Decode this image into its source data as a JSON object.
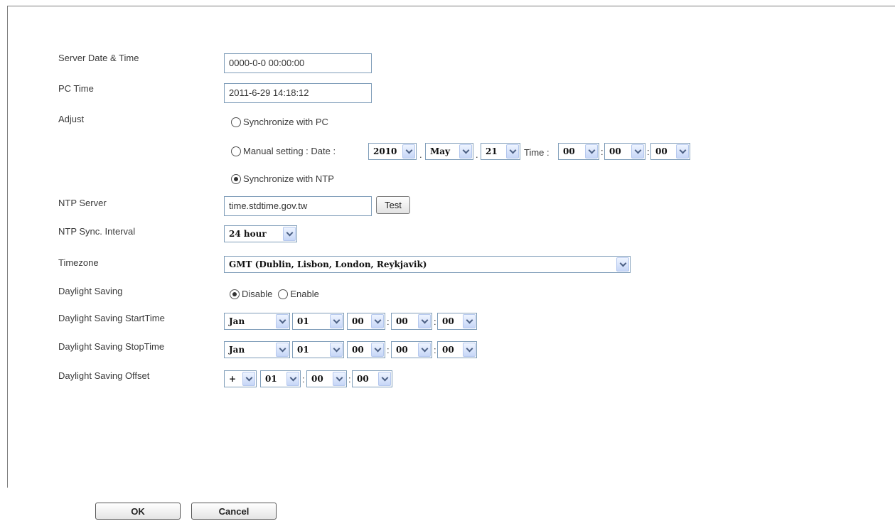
{
  "labels": {
    "server_datetime": "Server Date & Time",
    "pc_time": "PC Time",
    "adjust": "Adjust",
    "ntp_server": "NTP Server",
    "ntp_interval": "NTP Sync. Interval",
    "timezone": "Timezone",
    "daylight_saving": "Daylight Saving",
    "ds_start": "Daylight Saving StartTime",
    "ds_stop": "Daylight Saving StopTime",
    "ds_offset": "Daylight Saving Offset"
  },
  "values": {
    "server_datetime": "0000-0-0 00:00:00",
    "pc_time": "2011-6-29 14:18:12",
    "ntp_server": "time.stdtime.gov.tw",
    "ntp_interval": "24 hour",
    "timezone": "GMT (Dublin, Lisbon, London, Reykjavik)"
  },
  "adjust": {
    "sync_pc": "Synchronize with PC",
    "manual": "Manual setting : Date :",
    "time_label": "Time :",
    "sync_ntp": "Synchronize with NTP",
    "selected": "sync_ntp",
    "date": {
      "year": "2010",
      "month": "May",
      "day": "21"
    },
    "time": {
      "hour": "00",
      "minute": "00",
      "second": "00"
    }
  },
  "daylight": {
    "disable": "Disable",
    "enable": "Enable",
    "selected": "disable",
    "start": {
      "month": "Jan",
      "day": "01",
      "hour": "00",
      "minute": "00",
      "second": "00"
    },
    "stop": {
      "month": "Jan",
      "day": "01",
      "hour": "00",
      "minute": "00",
      "second": "00"
    },
    "offset": {
      "sign": "+",
      "hour": "01",
      "minute": "00",
      "second": "00"
    }
  },
  "separators": {
    "colon": ":",
    "dot": "."
  },
  "buttons": {
    "test": "Test",
    "ok": "OK",
    "cancel": "Cancel"
  }
}
